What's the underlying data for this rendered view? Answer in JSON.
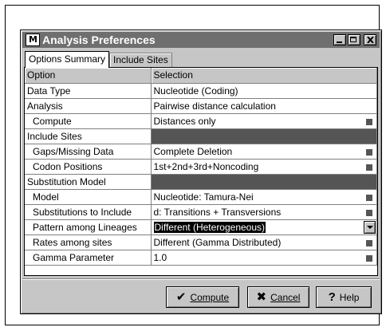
{
  "window": {
    "title": "Analysis Preferences",
    "icon": "M-app-icon",
    "icon_text": "M"
  },
  "tabs": [
    {
      "label": "Options Summary",
      "active": true
    },
    {
      "label": "Include Sites",
      "active": false
    }
  ],
  "grid": {
    "headers": [
      "Option",
      "Selection"
    ],
    "rows": [
      {
        "option": "Data Type",
        "value": "Nucleotide (Coding)",
        "indent": false,
        "marker": false
      },
      {
        "option": "Analysis",
        "value": "Pairwise distance calculation",
        "indent": false,
        "marker": false
      },
      {
        "option": "Compute",
        "value": "Distances only",
        "indent": true,
        "marker": true
      },
      {
        "option": "Include Sites",
        "value": "",
        "indent": false,
        "section": true
      },
      {
        "option": "Gaps/Missing Data",
        "value": "Complete Deletion",
        "indent": true,
        "marker": true
      },
      {
        "option": "Codon Positions",
        "value": "1st+2nd+3rd+Noncoding",
        "indent": true,
        "marker": true
      },
      {
        "option": "Substitution Model",
        "value": "",
        "indent": false,
        "section": true
      },
      {
        "option": "Model",
        "value": "Nucleotide: Tamura-Nei",
        "indent": true,
        "marker": true
      },
      {
        "option": "Substitutions to Include",
        "value": "d: Transitions + Transversions",
        "indent": true,
        "marker": true
      },
      {
        "option": "Pattern among Lineages",
        "value": "Different (Heterogeneous)",
        "indent": true,
        "selected": true,
        "dropdown": true
      },
      {
        "option": "Rates among sites",
        "value": "Different (Gamma Distributed)",
        "indent": true,
        "marker": true
      },
      {
        "option": "Gamma Parameter",
        "value": "1.0",
        "indent": true,
        "marker": true
      }
    ]
  },
  "buttons": {
    "compute": {
      "label": "Compute",
      "icon": "checkmark-icon"
    },
    "cancel": {
      "label": "Cancel",
      "icon": "x-icon"
    },
    "help": {
      "label": "Help",
      "icon": "question-mark-icon"
    }
  },
  "colors": {
    "title_bar": "#6f6f6f",
    "section_fill": "#555555",
    "selection": "#000000"
  }
}
